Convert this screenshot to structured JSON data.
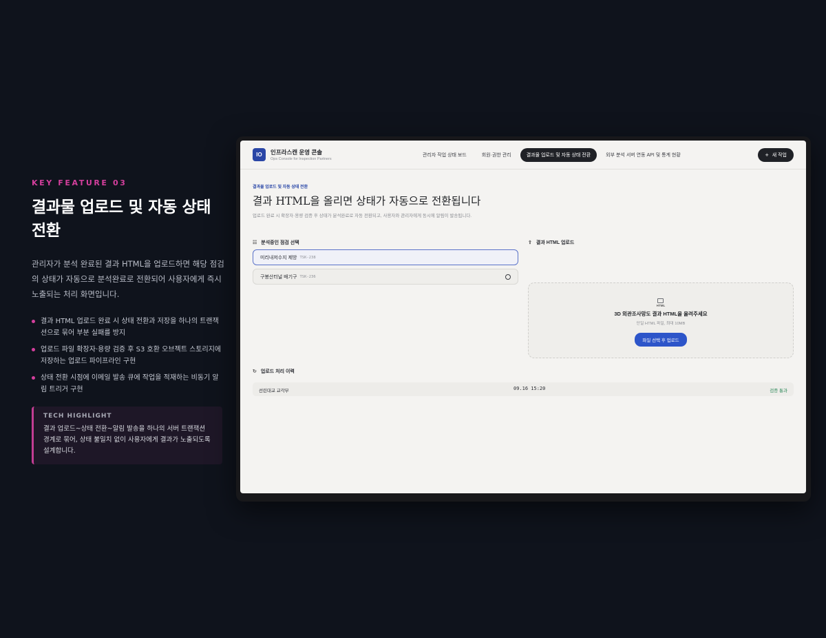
{
  "feature": {
    "eyebrow": "KEY FEATURE 03",
    "headline_line1": "결과물 업로드 및 자동 상태",
    "headline_line2": "전환",
    "description": "관리자가 분석 완료된 결과 HTML을 업로드하면 해당 점검의 상태가 자동으로 분석완료로 전환되어 사용자에게 즉시 노출되는 처리 화면입니다.",
    "bullets": [
      "결과 HTML 업로드 완료 시 상태 전환과 저장을 하나의 트랜잭션으로 묶어 부분 실패를 방지",
      "업로드 파일 확장자·용량 검증 후 S3 호환 오브젝트 스토리지에 저장하는 업로드 파이프라인 구현",
      "상태 전환 시점에 이메일 발송 큐에 작업을 적재하는 비동기 알림 트리거 구현"
    ],
    "tech_highlight": {
      "title": "TECH HIGHLIGHT",
      "body": "결과 업로드~상태 전환~알림 발송을 하나의 서버 트랜잭션 경계로 묶어, 상태 불일치 없이 사용자에게 결과가 노출되도록 설계합니다."
    },
    "accent_color": "#d43f9d"
  },
  "app": {
    "logo_text": "IO",
    "brand_name": "인프라스캔 운영 콘솔",
    "brand_sub": "Ops Console for Inspection Partners",
    "nav": [
      {
        "label": "관리자 작업 상태 보드",
        "active": false
      },
      {
        "label": "회원·권한 관리",
        "active": false
      },
      {
        "label": "결과물 업로드 및 자동 상태 전환",
        "active": true
      },
      {
        "label": "외부 분석 서버 연동 API 및 통계 현황",
        "active": false
      }
    ],
    "new_button": "새 작업",
    "breadcrumb": "결과물 업로드 및 자동 상태 전환",
    "page_title": "결과 HTML을 올리면 상태가 자동으로 전환됩니다",
    "page_desc": "업로드 완료 시 확장자·용량 검증 후 상태가 분석완료로 자동 전환되고, 사용자와 관리자에게 동시에 알림이 발송됩니다.",
    "task_section": "분석중인 점검 선택",
    "tasks": [
      {
        "name": "미리내저수지 제방",
        "code": "TSK-238",
        "selected": true
      },
      {
        "name": "구봉산터널 배기구",
        "code": "TSK-236",
        "selected": false
      }
    ],
    "upload_section": "결과 HTML 업로드",
    "dropzone": {
      "icon_label": "HTML",
      "title": "3D 외관조사망도 결과 HTML을 올려주세요",
      "subtitle": "단일 HTML 파일, 최대 10MB",
      "button": "파일 선택 후 업로드"
    },
    "history_section": "업로드 처리 이력",
    "history": [
      {
        "name": "선린대교 교각부",
        "time": "09.16 15:20",
        "status": "검증 통과"
      }
    ],
    "primary_color": "#2d55c9",
    "success_color": "#2f8a5b"
  }
}
